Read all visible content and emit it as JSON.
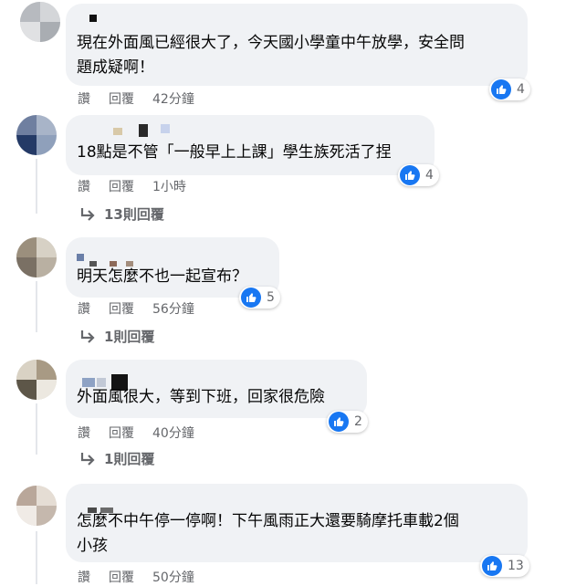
{
  "comments": [
    {
      "text": "現在外面風已經很大了，今天國小學童中午放學，安全問\n題成疑啊！",
      "reaction_count": "4",
      "like_label": "讚",
      "reply_label": "回覆",
      "time": "42分鐘"
    },
    {
      "text": "18點是不管「一般早上上課」學生族死活了捏",
      "reaction_count": "4",
      "like_label": "讚",
      "reply_label": "回覆",
      "time": "1小時",
      "replies": "13則回覆"
    },
    {
      "text": "明天怎麼不也一起宣布？",
      "reaction_count": "5",
      "like_label": "讚",
      "reply_label": "回覆",
      "time": "56分鐘",
      "replies": "1則回覆"
    },
    {
      "text": "外面風很大，等到下班，回家很危險",
      "reaction_count": "2",
      "like_label": "讚",
      "reply_label": "回覆",
      "time": "40分鐘",
      "replies": "1則回覆"
    },
    {
      "text": "怎麼不中午停一停啊！下午風雨正大還要騎摩托車載2個\n小孩",
      "reaction_count": "13",
      "like_label": "讚",
      "reply_label": "回覆",
      "time": "50分鐘"
    }
  ],
  "colors": {
    "bubble": "#f0f2f5",
    "like_blue": "#1877f2",
    "meta_gray": "#65676b"
  },
  "icons": [
    "thumbs-up-icon",
    "reply-arrow-icon"
  ]
}
